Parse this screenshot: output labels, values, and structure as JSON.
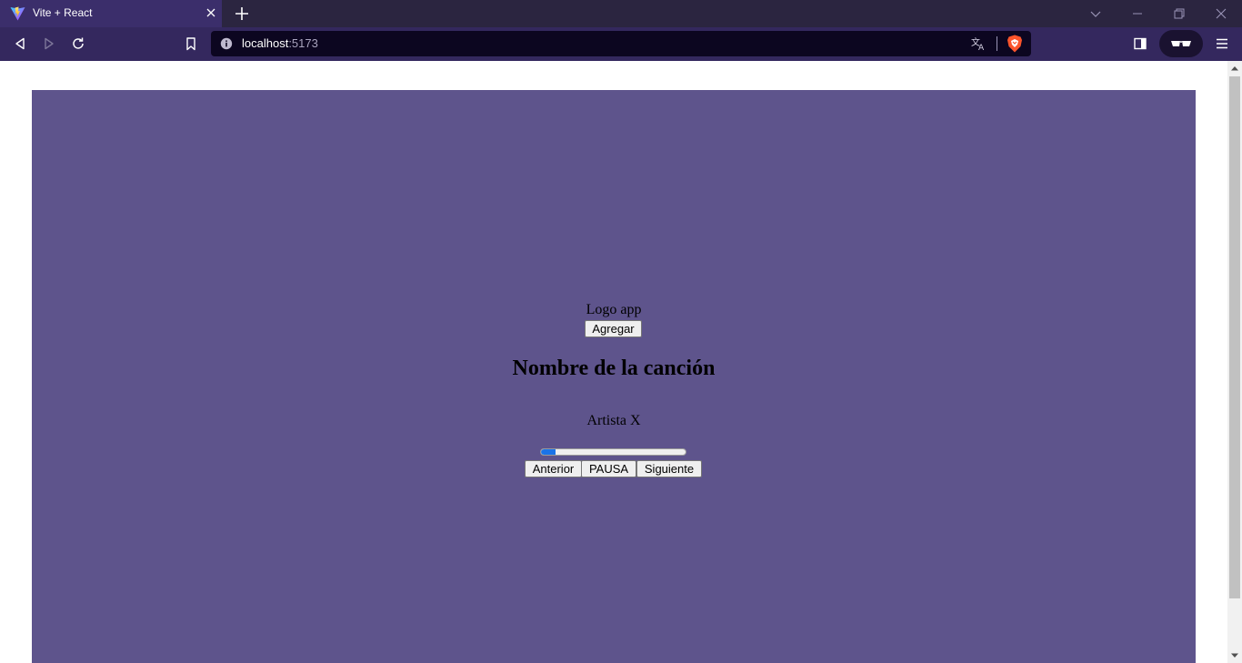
{
  "browser": {
    "tab": {
      "title": "Vite + React",
      "favicon": "vite-logo-icon"
    },
    "address_bar": {
      "host": "localhost",
      "port": ":5173"
    },
    "theme": {
      "tabstrip": "#2b2540",
      "toolbar": "#34285e",
      "address_bg": "#0c0620"
    }
  },
  "app": {
    "background": "#5e548c",
    "logo_text": "Logo app",
    "add_button": "Agregar",
    "song_title": "Nombre de la canción",
    "artist": "Artista X",
    "progress": 0.1,
    "controls": {
      "previous": "Anterior",
      "pause": "PAUSA",
      "next": "Siguiente"
    }
  }
}
